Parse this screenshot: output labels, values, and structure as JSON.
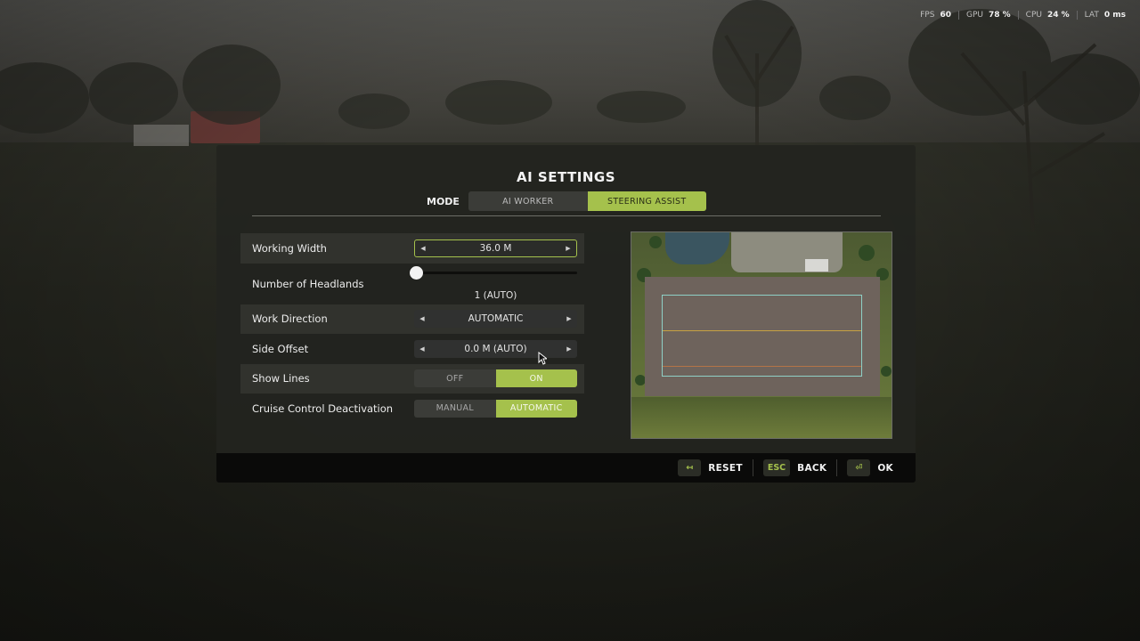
{
  "hud": {
    "fps_label": "FPS",
    "fps_value": "60",
    "gpu_label": "GPU",
    "gpu_value": "78 %",
    "cpu_label": "CPU",
    "cpu_value": "24 %",
    "lat_label": "LAT",
    "lat_value": "0 ms"
  },
  "dialog": {
    "title": "AI SETTINGS",
    "mode_label": "MODE",
    "mode_tabs": [
      {
        "label": "AI WORKER",
        "active": false
      },
      {
        "label": "STEERING ASSIST",
        "active": true
      }
    ]
  },
  "settings": {
    "working_width": {
      "label": "Working Width",
      "value": "36.0 M"
    },
    "headlands": {
      "label": "Number of Headlands",
      "value": "1 (AUTO)",
      "slider_fraction": 0
    },
    "work_direction": {
      "label": "Work Direction",
      "value": "AUTOMATIC"
    },
    "side_offset": {
      "label": "Side Offset",
      "value": "0.0 M (AUTO)"
    },
    "show_lines": {
      "label": "Show Lines",
      "options": [
        "OFF",
        "ON"
      ],
      "selected": "ON"
    },
    "cruise_control": {
      "label": "Cruise Control Deactivation",
      "options": [
        "MANUAL",
        "AUTOMATIC"
      ],
      "selected": "AUTOMATIC"
    }
  },
  "footer": {
    "reset": {
      "key_icon": "reset-arrows-icon",
      "label": "RESET"
    },
    "back": {
      "key": "ESC",
      "label": "BACK"
    },
    "ok": {
      "key_icon": "enter-key-icon",
      "label": "OK"
    }
  },
  "colors": {
    "accent": "#a5c14c",
    "panel": "#22231f",
    "footer": "#0a0a09"
  }
}
